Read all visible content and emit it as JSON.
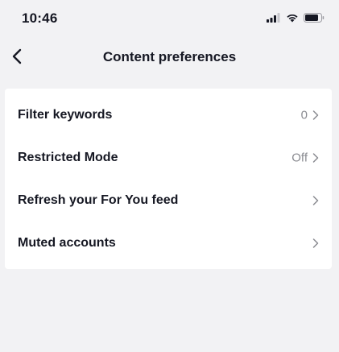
{
  "status_bar": {
    "time": "10:46",
    "icons": [
      "signal-icon",
      "wifi-icon",
      "battery-icon"
    ]
  },
  "header": {
    "title": "Content preferences",
    "back_icon": "chevron-left-icon"
  },
  "settings": {
    "items": [
      {
        "label": "Filter keywords",
        "value": "0"
      },
      {
        "label": "Restricted Mode",
        "value": "Off"
      },
      {
        "label": "Refresh your For You feed",
        "value": ""
      },
      {
        "label": "Muted accounts",
        "value": ""
      }
    ]
  },
  "colors": {
    "background": "#f2f2f4",
    "card": "#ffffff",
    "text": "#161823",
    "secondary_text": "#8a8b91"
  }
}
